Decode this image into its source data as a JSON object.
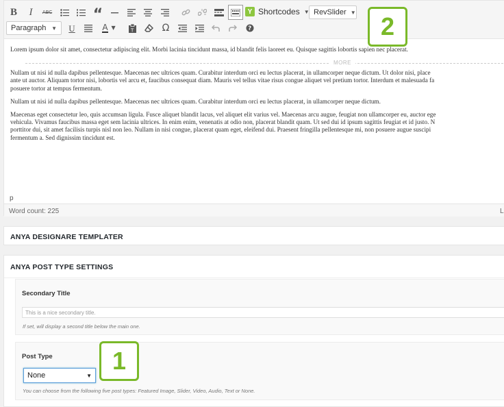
{
  "toolbar": {
    "row1": [
      {
        "name": "bold-button",
        "glyph": "B"
      },
      {
        "name": "italic-button",
        "glyph": "I"
      },
      {
        "name": "strikethrough-button",
        "glyph": "ABC"
      },
      {
        "name": "bullet-list-button",
        "glyph": "list"
      },
      {
        "name": "numbered-list-button",
        "glyph": "olist"
      },
      {
        "name": "blockquote-button",
        "glyph": "“"
      },
      {
        "name": "horizontal-rule-button",
        "glyph": "—"
      },
      {
        "name": "align-left-button",
        "glyph": "align"
      },
      {
        "name": "align-center-button",
        "glyph": "align"
      },
      {
        "name": "align-right-button",
        "glyph": "align"
      },
      {
        "name": "insert-link-button",
        "glyph": "link"
      },
      {
        "name": "remove-link-button",
        "glyph": "unlink"
      },
      {
        "name": "read-more-button",
        "glyph": "more"
      },
      {
        "name": "toolbar-toggle-button",
        "glyph": "kitchen"
      }
    ],
    "shortcodes_label": "Shortcodes",
    "revslider_label": "RevSlider",
    "format_select_value": "Paragraph",
    "row2": [
      {
        "name": "underline-button",
        "glyph": "U"
      },
      {
        "name": "justify-button",
        "glyph": "justify"
      },
      {
        "name": "text-color-button",
        "glyph": "A"
      },
      {
        "name": "paste-as-text-button",
        "glyph": "paste"
      },
      {
        "name": "clear-formatting-button",
        "glyph": "eraser"
      },
      {
        "name": "special-character-button",
        "glyph": "Ω"
      },
      {
        "name": "outdent-button",
        "glyph": "outdent"
      },
      {
        "name": "indent-button",
        "glyph": "indent"
      },
      {
        "name": "undo-button",
        "glyph": "undo"
      },
      {
        "name": "redo-button",
        "glyph": "redo"
      },
      {
        "name": "help-button",
        "glyph": "?"
      }
    ]
  },
  "callouts": {
    "one": "1",
    "two": "2"
  },
  "content": {
    "p1": "Lorem ipsum dolor sit amet, consectetur adipiscing elit. Morbi lacinia tincidunt massa, id blandit felis laoreet eu. Quisque sagittis lobortis sapien nec placerat.",
    "more_label": "MORE",
    "p2_lines": [
      "Nullam ut nisi id nulla dapibus pellentesque. Maecenas nec ultrices quam. Curabitur interdum orci eu lectus placerat, in ullamcorper neque dictum. Ut dolor nisi, place",
      "ante ut auctor. Aliquam tortor nisi, lobortis vel arcu et, faucibus consequat diam. Mauris vel tellus vitae risus congue aliquet vel pretium tortor. Interdum et malesuada fa",
      "posuere tortor at tempus fermentum."
    ],
    "p3": "Nullam ut nisi id nulla dapibus pellentesque. Maecenas nec ultrices quam. Curabitur interdum orci eu lectus placerat, in ullamcorper neque dictum.",
    "p4_lines": [
      "Maecenas eget consectetur leo, quis accumsan ligula. Fusce aliquet blandit lacus, vel aliquet elit varius vel. Maecenas arcu augue, feugiat non ullamcorper eu, auctor ege",
      "vehicula. Vivamus faucibus massa eget sem lacinia ultrices. In enim enim, venenatis at odio non, placerat blandit quam. Ut sed dui id ipsum sagittis feugiat et id justo. N",
      "porttitor dui, sit amet facilisis turpis nisl non leo. Nullam in nisi congue, placerat quam eget, eleifend dui. Praesent fringilla pellentesque mi, non posuere augue suscipi",
      "fermentum a. Sed dignissim tincidunt est."
    ]
  },
  "status": {
    "path": "p",
    "word_count": "Word count: 225",
    "last_edited": "La"
  },
  "designare_box": {
    "title": "ANYA DESIGNARE TEMPLATER"
  },
  "post_settings": {
    "title": "ANYA POST TYPE SETTINGS",
    "secondary_title": {
      "label": "Secondary Title",
      "placeholder": "This is a nice secondary title.",
      "hint": "If set, will display a second title below the main one."
    },
    "post_type": {
      "label": "Post Type",
      "value": "None",
      "hint": "You can choose from the following five post types: Featured Image, Slider, Video, Audio, Text or None."
    }
  },
  "colors": {
    "accent_green": "#7ab929",
    "focus_blue": "#5b9dd9"
  }
}
